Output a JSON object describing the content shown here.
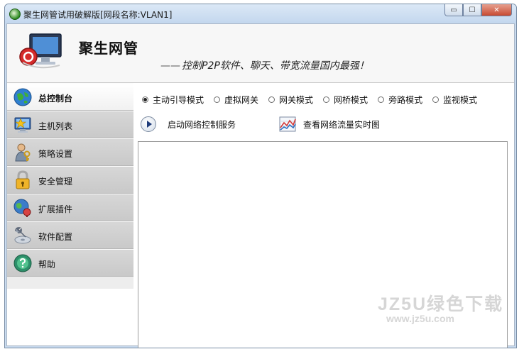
{
  "window": {
    "title": "聚生网管试用破解版[网段名称:VLAN1]",
    "controls": {
      "minimize": "▭",
      "maximize": "☐",
      "close": "✕"
    }
  },
  "header": {
    "brand": "聚生网管",
    "slogan": "控制P2P软件、聊天、带宽流量国内最强！"
  },
  "sidebar": {
    "items": [
      {
        "label": "总控制台",
        "icon": "globe-icon",
        "active": true
      },
      {
        "label": "主机列表",
        "icon": "monitor-star-icon",
        "active": false
      },
      {
        "label": "策略设置",
        "icon": "person-key-icon",
        "active": false
      },
      {
        "label": "安全管理",
        "icon": "lock-icon",
        "active": false
      },
      {
        "label": "扩展插件",
        "icon": "globe-pin-icon",
        "active": false
      },
      {
        "label": "软件配置",
        "icon": "wrench-disc-icon",
        "active": false
      },
      {
        "label": "帮助",
        "icon": "help-globe-icon",
        "active": false
      }
    ]
  },
  "modes": {
    "selected": "主动引导模式",
    "options": [
      "主动引导模式",
      "虚拟网关",
      "网关模式",
      "网桥模式",
      "旁路模式",
      "监视模式"
    ]
  },
  "actions": {
    "start_service": "启动网络控制服务",
    "view_traffic": "查看网络流量实时图"
  },
  "watermark": {
    "line1": "JZ5U绿色下载",
    "line2": "www.jz5u.com"
  }
}
